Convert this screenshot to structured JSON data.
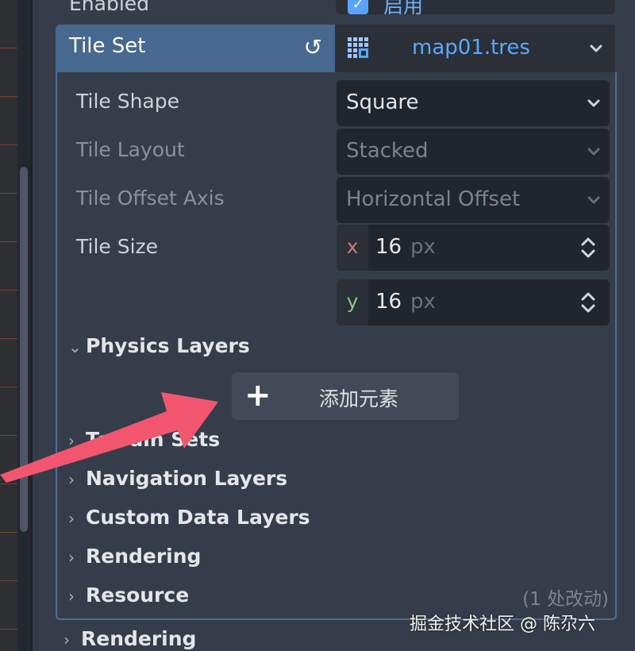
{
  "top_row": {
    "label": "Enabled",
    "checkbox_label": "启用",
    "checked": true
  },
  "tile_set": {
    "header_label": "Tile Set",
    "revert_icon": "revert-icon",
    "resource_name": "map01.tres",
    "resource_icon": "tileset-resource-icon"
  },
  "properties": [
    {
      "label": "Tile Shape",
      "value": "Square",
      "enabled": true
    },
    {
      "label": "Tile Layout",
      "value": "Stacked",
      "enabled": false
    },
    {
      "label": "Tile Offset Axis",
      "value": "Horizontal Offset",
      "enabled": false
    }
  ],
  "tile_size": {
    "label": "Tile Size",
    "x": {
      "axis": "x",
      "value": "16",
      "unit": "px"
    },
    "y": {
      "axis": "y",
      "value": "16",
      "unit": "px"
    }
  },
  "sections": {
    "physics_layers": {
      "label": "Physics Layers",
      "expanded": true
    },
    "add_element": "添加元素",
    "collapsed": [
      "Terrain Sets",
      "Navigation Layers",
      "Custom Data Layers",
      "Rendering",
      "Resource"
    ],
    "outer_rendering": "Rendering"
  },
  "changes_note": "(1 处改动)",
  "watermark": "掘金技术社区 @ 陈尕六",
  "colors": {
    "header_bg": "#47688f",
    "accent_blue": "#5aa9ff",
    "annotation_arrow": "#f2566f",
    "panel_bg": "#363d4a"
  }
}
